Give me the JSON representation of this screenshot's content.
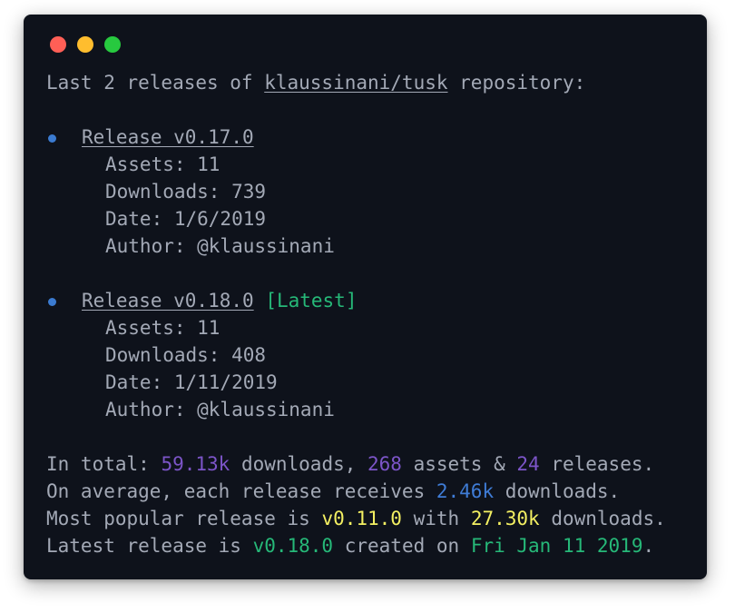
{
  "intro": {
    "prefix": "Last 2 releases of ",
    "repo": "klaussinani/tusk",
    "suffix": " repository:"
  },
  "releases": [
    {
      "title": "Release v0.17.0",
      "tag": "",
      "assets": "Assets: 11",
      "downloads": "Downloads: 739",
      "date": "Date: 1/6/2019",
      "author": "Author: @klaussinani"
    },
    {
      "title": "Release v0.18.0",
      "tag": "[Latest]",
      "assets": "Assets: 11",
      "downloads": "Downloads: 408",
      "date": "Date: 1/11/2019",
      "author": "Author: @klaussinani"
    }
  ],
  "summary": {
    "total": {
      "p1": "In total: ",
      "downloads": "59.13k",
      "p2": " downloads, ",
      "assets": "268",
      "p3": " assets & ",
      "releases": "24",
      "p4": " releases."
    },
    "average": {
      "p1": "On average, each release receives ",
      "value": "2.46k",
      "p2": " downloads."
    },
    "popular": {
      "p1": "Most popular release is ",
      "release": "v0.11.0",
      "p2": " with ",
      "downloads": "27.30k",
      "p3": " downloads."
    },
    "latest": {
      "p1": "Latest release is ",
      "release": "v0.18.0",
      "p2": " created on ",
      "date": "Fri Jan 11 2019",
      "p3": "."
    }
  },
  "colors": {
    "background": "#0e121b",
    "text": "#a3a9b6",
    "bullet": "#3b7bd1",
    "purple": "#7c55c8",
    "blue": "#3f7cd6",
    "yellow": "#f3ef62",
    "green": "#26b878"
  }
}
